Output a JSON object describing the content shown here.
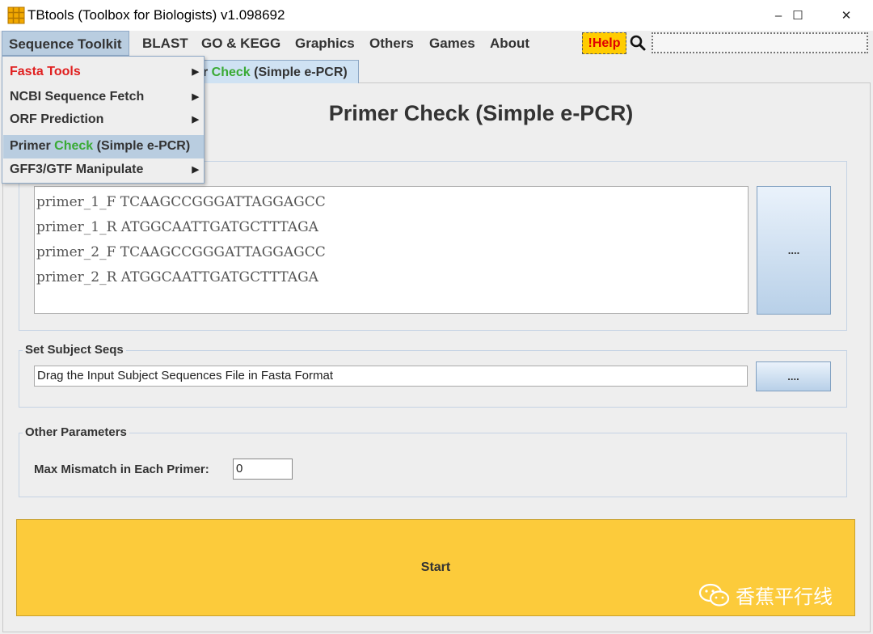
{
  "window": {
    "title": "TBtools (Toolbox for Biologists) v1.098692",
    "minimize": "–",
    "maximize": "☐",
    "close": "✕"
  },
  "menubar": {
    "items": [
      "Sequence Toolkit",
      "BLAST",
      "GO & KEGG",
      "Graphics",
      "Others",
      "Games",
      "About"
    ],
    "help": "!Help",
    "search_value": ""
  },
  "dropdown": {
    "items": [
      {
        "label": "Fasta Tools",
        "submenu": true,
        "color": "#e02020"
      },
      {
        "label": "NCBI Sequence Fetch",
        "submenu": true
      },
      {
        "label": "ORF Prediction",
        "submenu": true
      },
      {
        "label_pre": "Primer ",
        "label_green": "Check",
        "label_post": " (Simple e-PCR)",
        "submenu": false,
        "selected": true
      },
      {
        "label": "GFF3/GTF Manipulate",
        "submenu": true
      }
    ]
  },
  "tab": {
    "pre": "r ",
    "green": "Check",
    "post": " (Simple e-PCR)"
  },
  "main": {
    "heading": "Primer Check (Simple e-PCR)",
    "primers": [
      "primer_1_F TCAAGCCGGGATTAGGAGCC",
      "primer_1_R ATGGCAATTGATGCTTTAGA",
      "primer_2_F TCAAGCCGGGATTAGGAGCC",
      "primer_2_R ATGGCAATTGATGCTTTAGA"
    ],
    "primer_browse": "....",
    "subject_group": "Set Subject Seqs",
    "subject_value": "Drag the Input Subject Sequences File in Fasta Format",
    "subject_browse": "....",
    "params_group": "Other Parameters",
    "mismatch_label": "Max Mismatch in Each Primer:",
    "mismatch_value": "0",
    "start": "Start"
  },
  "watermark": "香蕉平行线",
  "colors": {
    "accent_green": "#3aaa35",
    "menu_red": "#e02020",
    "start_yellow": "#fccb3b",
    "help_yellow": "#ffcc00"
  }
}
